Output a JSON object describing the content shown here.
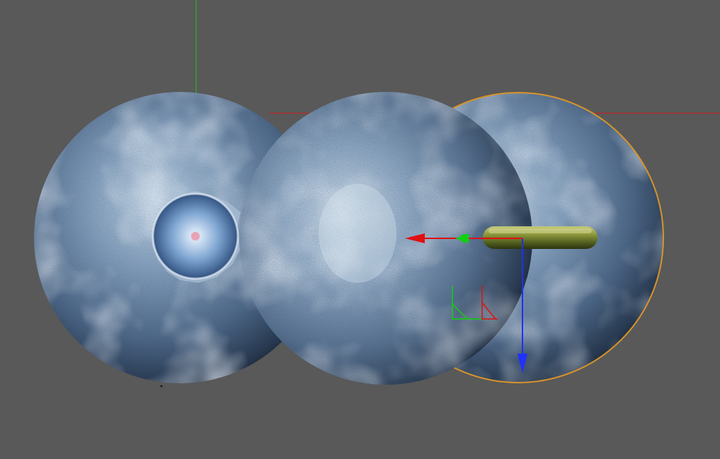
{
  "viewport": {
    "background_color": "#595959",
    "axis_colors": {
      "x": "#e01010",
      "y": "#10d010",
      "z": "#2030ff"
    },
    "selection_outline_color": "#d8942a"
  },
  "scene": {
    "objects": [
      {
        "name": "blueberry-left",
        "kind": "sphere"
      },
      {
        "name": "blueberry-center",
        "kind": "sphere"
      },
      {
        "name": "blueberry-right",
        "kind": "sphere",
        "selected": true
      },
      {
        "name": "berry-crown",
        "kind": "calyx"
      },
      {
        "name": "berry-stem",
        "kind": "stem"
      }
    ],
    "icons": {
      "move_gizmo": "move-gizmo-icon",
      "snap_corner": "snap-corner-icon"
    }
  }
}
